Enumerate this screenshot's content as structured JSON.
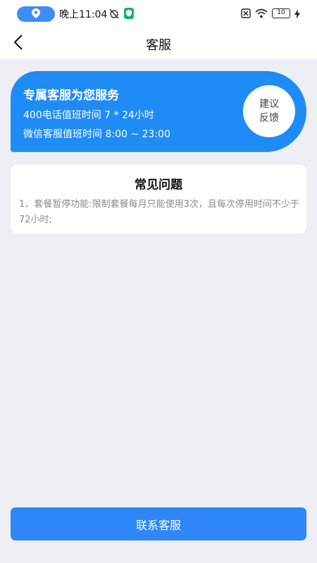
{
  "status_bar": {
    "time": "晚上11:04",
    "battery_level": "10",
    "icons": [
      "location-icon",
      "alarm-off-icon",
      "security-shield-icon",
      "sim-off-icon",
      "wifi-icon",
      "battery-icon",
      "charging-icon"
    ]
  },
  "nav": {
    "title": "客服",
    "back_icon": "chevron-left-icon"
  },
  "banner": {
    "title": "专属客服为您服务",
    "phone_hours": "400电话值班时间 7 * 24小时",
    "wechat_hours": "微信客服值班时间 8:00 ~ 23:00",
    "feedback_line1": "建议",
    "feedback_line2": "反馈",
    "color": "#1f8cf6"
  },
  "faq": {
    "title": "常见问题",
    "items": [
      "1、套餐暂停功能:限制套餐每月只能使用3次，且每次停用时间不少于72小时;"
    ]
  },
  "actions": {
    "contact_label": "联系客服",
    "color": "#2f86f6"
  }
}
